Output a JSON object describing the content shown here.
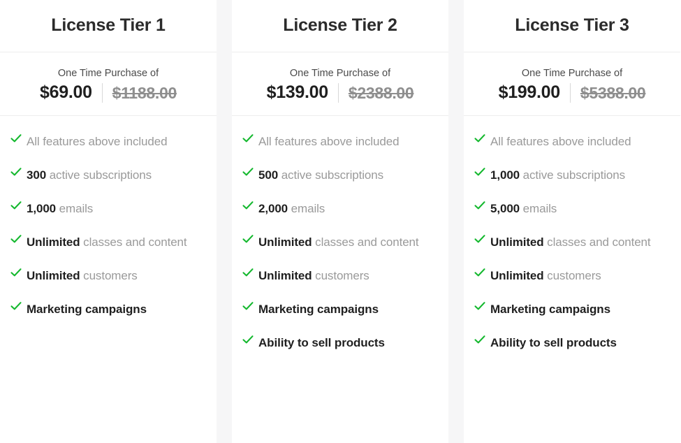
{
  "theme": {
    "check_color": "#14b82e",
    "value_color": "#1f1f1f",
    "muted_color": "#9a9a9a",
    "title_color": "#2b2b2b",
    "rule_color": "#ededed",
    "gutter_color": "#f6f6f7",
    "strike_color": "#8e8e8e"
  },
  "icons": {
    "check": "check-icon"
  },
  "columns": [
    {
      "title": "License Tier 1",
      "price_caption": "One Time Purchase of",
      "price_current": "$69.00",
      "price_original": "$1188.00",
      "features": [
        {
          "strong": "",
          "rest": "All features above included",
          "all_muted": true
        },
        {
          "strong": "300",
          "rest": " active subscriptions",
          "all_muted": false
        },
        {
          "strong": "1,000",
          "rest": " emails",
          "all_muted": false
        },
        {
          "strong": "Unlimited",
          "rest": " classes and content",
          "all_muted": false
        },
        {
          "strong": "Unlimited",
          "rest": " customers",
          "all_muted": false
        },
        {
          "strong": "Marketing campaigns",
          "rest": "",
          "all_muted": false
        }
      ]
    },
    {
      "title": "License Tier 2",
      "price_caption": "One Time Purchase of",
      "price_current": "$139.00",
      "price_original": "$2388.00",
      "features": [
        {
          "strong": "",
          "rest": "All features above included",
          "all_muted": true
        },
        {
          "strong": "500",
          "rest": " active subscriptions",
          "all_muted": false
        },
        {
          "strong": "2,000",
          "rest": " emails",
          "all_muted": false
        },
        {
          "strong": "Unlimited",
          "rest": " classes and content",
          "all_muted": false
        },
        {
          "strong": "Unlimited",
          "rest": " customers",
          "all_muted": false
        },
        {
          "strong": "Marketing campaigns",
          "rest": "",
          "all_muted": false
        },
        {
          "strong": "Ability to sell products",
          "rest": "",
          "all_muted": false
        }
      ]
    },
    {
      "title": "License Tier 3",
      "price_caption": "One Time Purchase of",
      "price_current": "$199.00",
      "price_original": "$5388.00",
      "features": [
        {
          "strong": "",
          "rest": "All features above included",
          "all_muted": true
        },
        {
          "strong": "1,000",
          "rest": " active subscriptions",
          "all_muted": false
        },
        {
          "strong": "5,000",
          "rest": " emails",
          "all_muted": false
        },
        {
          "strong": "Unlimited",
          "rest": " classes and content",
          "all_muted": false
        },
        {
          "strong": "Unlimited",
          "rest": " customers",
          "all_muted": false
        },
        {
          "strong": "Marketing campaigns",
          "rest": "",
          "all_muted": false
        },
        {
          "strong": "Ability to sell products",
          "rest": "",
          "all_muted": false
        }
      ]
    }
  ]
}
